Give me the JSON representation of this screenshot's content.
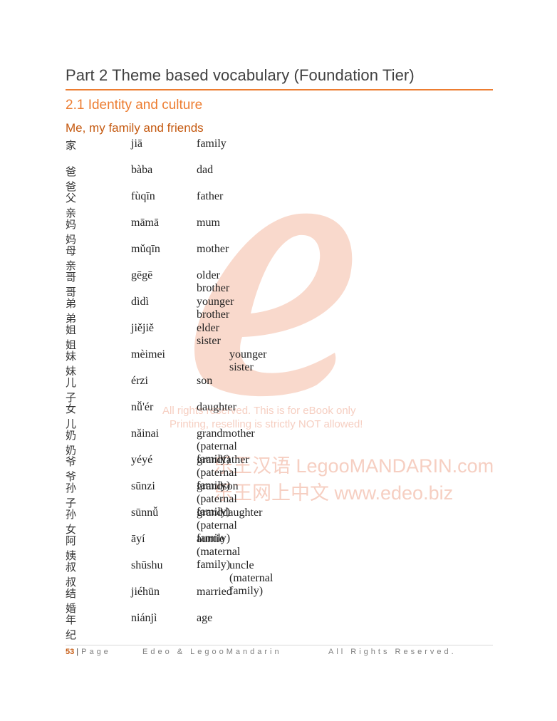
{
  "header": {
    "part_title": "Part 2 Theme based vocabulary (Foundation Tier)",
    "section_title": "2.1 Identity and culture",
    "subsection_title": "Me, my family and friends"
  },
  "colors": {
    "accent": "#ed7d31",
    "subheading": "#c55a11",
    "watermark": "#f6cfc2"
  },
  "watermark": {
    "line1": "All rights reserved. This is for eBook only",
    "line2": "Printing, reselling is strictly NOT allowed!",
    "line3": "乐王汉语 LegooMANDARIN.com",
    "line4": "乐王网上中文 www.edeo.biz"
  },
  "vocabulary": [
    {
      "hanzi": "家",
      "pinyin": "jiā",
      "english": "family",
      "indent": false
    },
    {
      "hanzi": "爸爸",
      "pinyin": "bàba",
      "english": "dad",
      "indent": false
    },
    {
      "hanzi": "父亲",
      "pinyin": "fùqīn",
      "english": "father",
      "indent": false
    },
    {
      "hanzi": "妈妈",
      "pinyin": "māmā",
      "english": "mum",
      "indent": false
    },
    {
      "hanzi": "母亲",
      "pinyin": "mǔqīn",
      "english": "mother",
      "indent": false
    },
    {
      "hanzi": "哥哥",
      "pinyin": "gēgē",
      "english": "older brother",
      "indent": false
    },
    {
      "hanzi": "弟弟",
      "pinyin": "dìdì",
      "english": "younger brother",
      "indent": false
    },
    {
      "hanzi": "姐姐",
      "pinyin": "jiějiě",
      "english": "elder sister",
      "indent": false
    },
    {
      "hanzi": "妹妹",
      "pinyin": "mèimei",
      "english": "younger sister",
      "indent": true
    },
    {
      "hanzi": "儿子",
      "pinyin": "érzi",
      "english": "son",
      "indent": false
    },
    {
      "hanzi": "女儿",
      "pinyin": "nǚ'ér",
      "english": "daughter",
      "indent": false
    },
    {
      "hanzi": "奶奶",
      "pinyin": "nǎinai",
      "english": "grandmother (paternal family)",
      "indent": false
    },
    {
      "hanzi": "爷爷",
      "pinyin": "yéyé",
      "english": "grandfather (paternal family)",
      "indent": false
    },
    {
      "hanzi": "孙子",
      "pinyin": "sūnzi",
      "english": "grandson (paternal family)",
      "indent": false
    },
    {
      "hanzi": "孙女",
      "pinyin": "sūnnǚ",
      "english": "granddaughter (paternal family)",
      "indent": false
    },
    {
      "hanzi": "阿姨",
      "pinyin": "āyí",
      "english": "auntie (maternal family)",
      "indent": false
    },
    {
      "hanzi": "叔叔",
      "pinyin": "shūshu",
      "english": "uncle (maternal family)",
      "indent": true
    },
    {
      "hanzi": "结婚",
      "pinyin": "jiéhūn",
      "english": "married",
      "indent": false
    },
    {
      "hanzi": "年纪",
      "pinyin": "niánjì",
      "english": "age",
      "indent": false
    }
  ],
  "footer": {
    "page_number": "53",
    "separator": "|",
    "page_label": "Page",
    "company": "Edeo & LegooMandarin",
    "rights": "All Rights Reserved."
  }
}
